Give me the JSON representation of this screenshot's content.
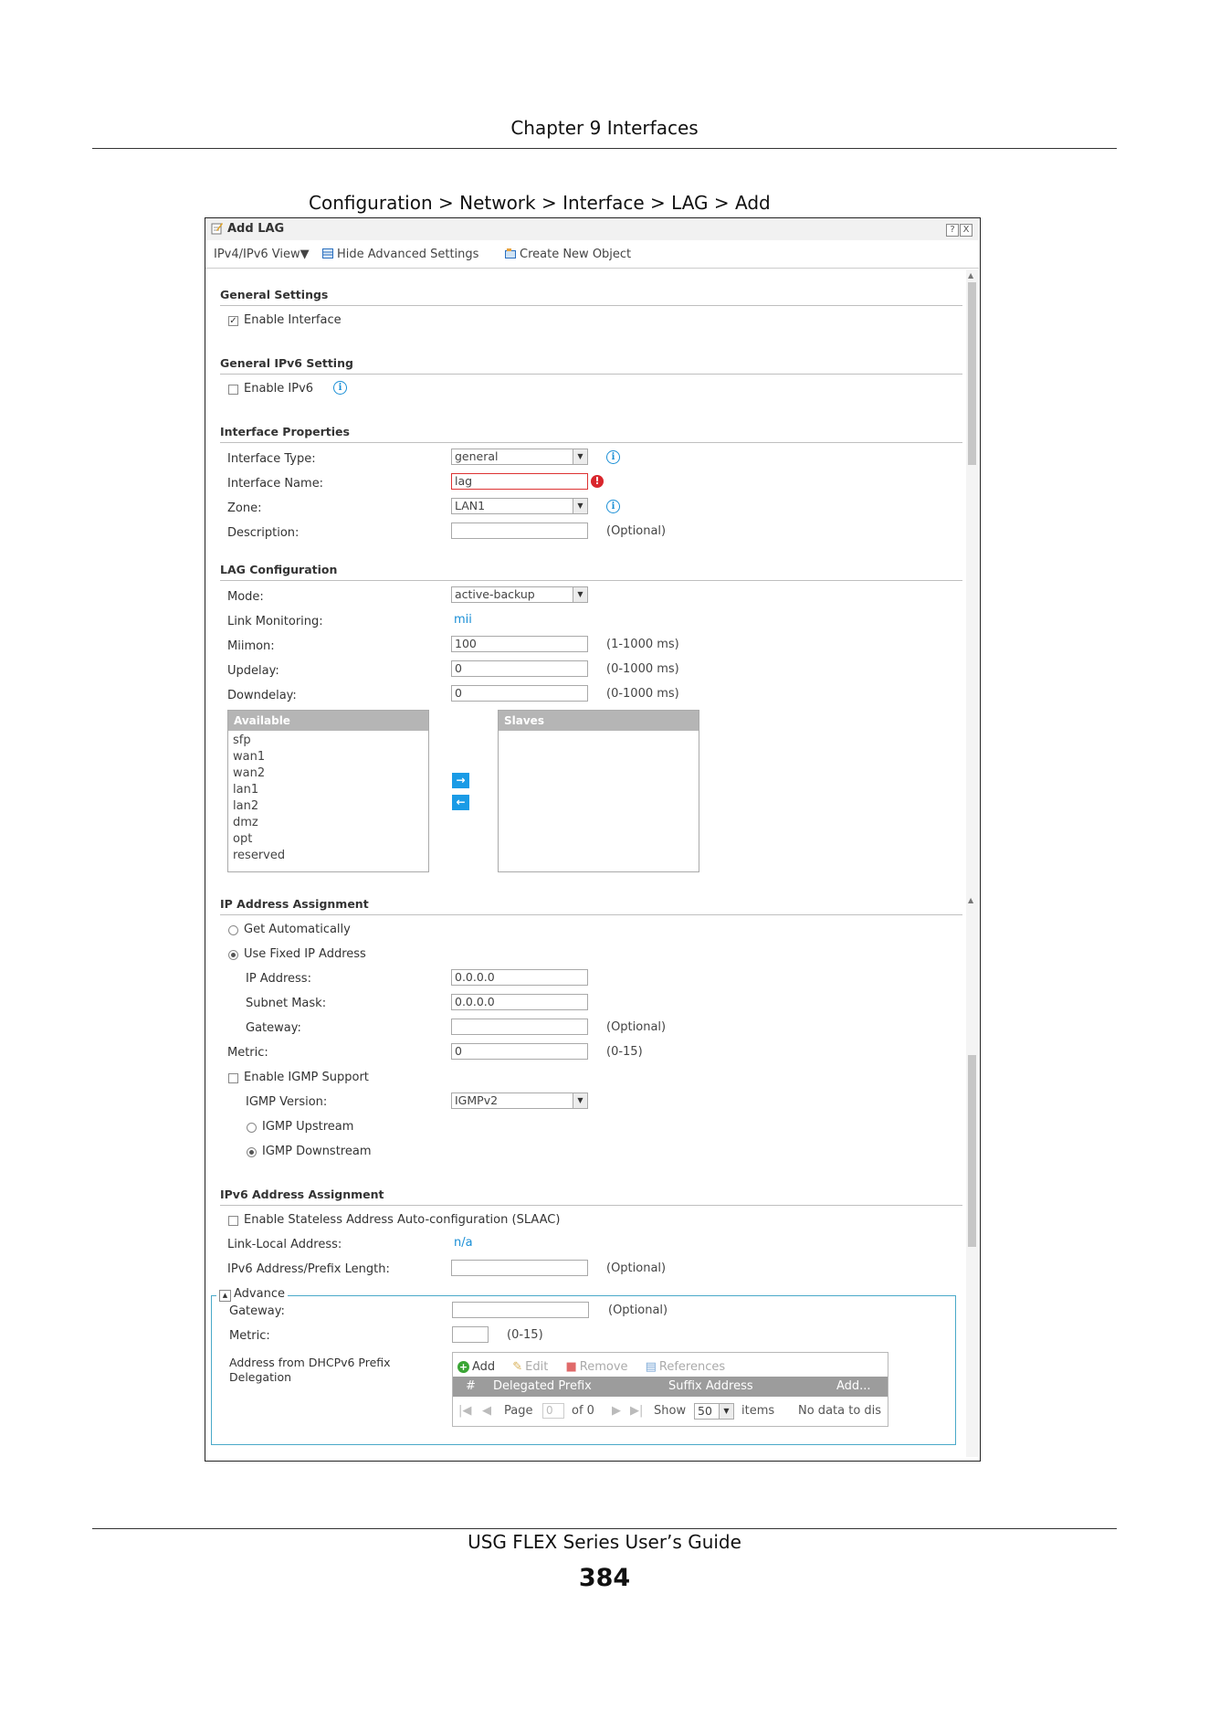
{
  "page": {
    "chapter_header": "Chapter 9 Interfaces",
    "figure_caption": "Configuration > Network > Interface > LAG > Add",
    "footer_title": "USG FLEX Series User’s Guide",
    "page_number": "384"
  },
  "dialog": {
    "title": "Add LAG",
    "help_button": "?",
    "close_button": "X",
    "toolbar": {
      "view_menu": "IPv4/IPv6 View▼",
      "hide_advanced": "Hide Advanced Settings",
      "create_object": "Create New Object"
    }
  },
  "general_settings": {
    "heading": "General Settings",
    "enable_interface": {
      "label": "Enable Interface",
      "checked": true
    }
  },
  "general_ipv6": {
    "heading": "General IPv6 Setting",
    "enable_ipv6": {
      "label": "Enable IPv6",
      "checked": false
    }
  },
  "interface_properties": {
    "heading": "Interface Properties",
    "type_label": "Interface Type:",
    "type_value": "general",
    "name_label": "Interface Name:",
    "name_value": "lag",
    "zone_label": "Zone:",
    "zone_value": "LAN1",
    "description_label": "Description:",
    "description_value": "",
    "optional_note": "(Optional)"
  },
  "lag_config": {
    "heading": "LAG Configuration",
    "mode_label": "Mode:",
    "mode_value": "active-backup",
    "link_monitoring_label": "Link Monitoring:",
    "link_monitoring_value": "mii",
    "miimon_label": "Miimon:",
    "miimon_value": "100",
    "miimon_range": "(1-1000 ms)",
    "updelay_label": "Updelay:",
    "updelay_value": "0",
    "updelay_range": "(0-1000 ms)",
    "downdelay_label": "Downdelay:",
    "downdelay_value": "0",
    "downdelay_range": "(0-1000 ms)",
    "available_header": "Available",
    "available_items": [
      "sfp",
      "wan1",
      "wan2",
      "lan1",
      "lan2",
      "dmz",
      "opt",
      "reserved"
    ],
    "slaves_header": "Slaves",
    "move_right": "→",
    "move_left": "←"
  },
  "ip_assignment": {
    "heading": "IP Address Assignment",
    "get_auto": {
      "label": "Get Automatically",
      "selected": false
    },
    "use_fixed": {
      "label": "Use Fixed IP Address",
      "selected": true
    },
    "ip_label": "IP Address:",
    "ip_value": "0.0.0.0",
    "mask_label": "Subnet Mask:",
    "mask_value": "0.0.0.0",
    "gateway_label": "Gateway:",
    "gateway_value": "",
    "gateway_note": "(Optional)",
    "metric_label": "Metric:",
    "metric_value": "0",
    "metric_range": "(0-15)",
    "igmp_enable": {
      "label": "Enable IGMP Support",
      "checked": false
    },
    "igmp_version_label": "IGMP Version:",
    "igmp_version_value": "IGMPv2",
    "igmp_upstream": {
      "label": "IGMP Upstream",
      "selected": false
    },
    "igmp_downstream": {
      "label": "IGMP Downstream",
      "selected": true
    }
  },
  "ipv6_assignment": {
    "heading": "IPv6 Address Assignment",
    "slaac": {
      "label": "Enable Stateless Address Auto-configuration (SLAAC)",
      "checked": false
    },
    "link_local_label": "Link-Local Address:",
    "link_local_value": "n/a",
    "prefix_label": "IPv6 Address/Prefix Length:",
    "prefix_value": "",
    "prefix_note": "(Optional)",
    "advance": {
      "legend": "Advance",
      "toggle": "▲",
      "gateway_label": "Gateway:",
      "gateway_value": "",
      "gateway_note": "(Optional)",
      "metric_label": "Metric:",
      "metric_value": "",
      "metric_range": "(0-15)",
      "dhcp_label_line1": "Address from DHCPv6 Prefix",
      "dhcp_label_line2": "Delegation",
      "grid": {
        "add": "Add",
        "edit": "Edit",
        "remove": "Remove",
        "references": "References",
        "columns": [
          "#",
          "Delegated Prefix",
          "Suffix Address",
          "Add..."
        ],
        "page_label": "Page",
        "page_value": "0",
        "of_label": "of 0",
        "show_label": "Show",
        "show_value": "50",
        "items_label": "items",
        "no_data": "No data to dis"
      }
    }
  },
  "colors": {
    "accent": "#1a8fd6",
    "error": "#d9262c",
    "list_header": "#b5b5b5",
    "advance_border": "#4aa9c9"
  }
}
